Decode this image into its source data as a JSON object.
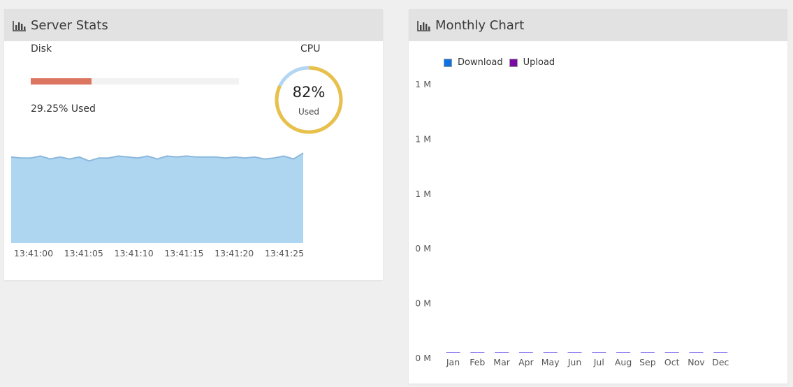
{
  "server_stats": {
    "title": "Server Stats",
    "icon": "bar-chart-icon",
    "disk": {
      "label": "Disk",
      "used_text": "29.25% Used",
      "used_fraction": 0.2925,
      "bar_color": "#dc7660"
    },
    "cpu": {
      "label": "CPU",
      "percent_text": "82%",
      "sub": "Used",
      "used_fraction": 0.82,
      "used_color": "#e8c04a",
      "free_color": "#b3d6f3"
    },
    "live_chart": {
      "x_ticks": [
        "13:41:00",
        "13:41:05",
        "13:41:10",
        "13:41:15",
        "13:41:20",
        "13:41:25"
      ],
      "fill_color": "#aed6f1",
      "line_color": "#8ab8dc",
      "values": [
        88,
        87,
        87,
        89,
        86,
        88,
        86,
        88,
        84,
        87,
        87,
        89,
        88,
        87,
        89,
        86,
        89,
        88,
        89,
        88,
        88,
        88,
        87,
        88,
        87,
        88,
        86,
        87,
        89,
        86,
        92
      ]
    }
  },
  "monthly_chart": {
    "title": "Monthly Chart",
    "icon": "bar-chart-icon",
    "legend": [
      {
        "name": "Download",
        "color": "#0d72e6"
      },
      {
        "name": "Upload",
        "color": "#7a0aa3"
      }
    ],
    "chart_data": {
      "type": "bar",
      "categories": [
        "Jan",
        "Feb",
        "Mar",
        "Apr",
        "May",
        "Jun",
        "Jul",
        "Aug",
        "Sep",
        "Oct",
        "Nov",
        "Dec"
      ],
      "series": [
        {
          "name": "Download",
          "values": [
            0,
            0,
            0,
            0,
            0,
            0,
            0,
            0,
            0,
            0,
            0,
            0
          ]
        },
        {
          "name": "Upload",
          "values": [
            0,
            0,
            0,
            0,
            0,
            0,
            0,
            0,
            0,
            0,
            0,
            0
          ]
        }
      ],
      "y_tick_labels": [
        "1 M",
        "1 M",
        "1 M",
        "0 M",
        "0 M",
        "0 M"
      ],
      "legend_position": "top-left",
      "grid": false
    }
  }
}
